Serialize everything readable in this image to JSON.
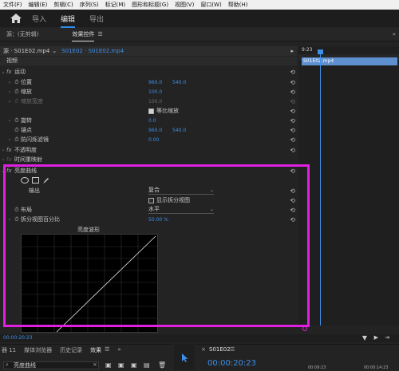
{
  "menu": [
    "文件(F)",
    "编辑(E)",
    "剪辑(C)",
    "序列(S)",
    "标记(M)",
    "图形和标题(G)",
    "视图(V)",
    "窗口(W)",
    "帮助(H)"
  ],
  "workspace_tabs": [
    "导入",
    "编辑",
    "导出"
  ],
  "panel_header": {
    "source": "源：(无剪辑)",
    "effect_controls": "效果控件"
  },
  "source_line": {
    "label": "源 · S01E02.mp4",
    "clip": "S01E02 · S01E02.mp4"
  },
  "video_label": "视频",
  "timeline": {
    "time": "9:23",
    "clip_name": "S01E02.mp4"
  },
  "effects": {
    "motion": {
      "label": "运动"
    },
    "position": {
      "label": "位置",
      "x": "960.0",
      "y": "540.0"
    },
    "scale": {
      "label": "缩放",
      "value": "100.0"
    },
    "scale_width": {
      "label": "缩放宽度",
      "value": "100.0"
    },
    "uniform_scale": {
      "label": "等比缩放"
    },
    "rotation": {
      "label": "旋转",
      "value": "0.0"
    },
    "anchor": {
      "label": "锚点",
      "x": "960.0",
      "y": "540.0"
    },
    "antiflicker": {
      "label": "防闪烁滤镜",
      "value": "0.00"
    },
    "opacity": {
      "label": "不透明度"
    },
    "time_remap": {
      "label": "时间重映射"
    },
    "lumetri_curves": {
      "label": "亮度曲线"
    },
    "output": {
      "label": "输出",
      "value": "复合"
    },
    "split_view_show": {
      "label": "显示拆分视图"
    },
    "layout": {
      "label": "布局",
      "value": "水平"
    },
    "split_percent": {
      "label": "拆分视图百分比",
      "value": "50.00 %"
    },
    "waveform_title": "亮度波形"
  },
  "bottom_time": "00:00:20:23",
  "bottom_panel": {
    "tabs": [
      "媒体浏览器",
      "历史记录",
      "效果"
    ],
    "tab_prefix": "器 11",
    "search_value": "亮度曲线"
  },
  "sequence": {
    "name": "S01E02",
    "timecode": "00:00:20:23",
    "small_time": "00:09:23",
    "right_time": "00:00:14:23"
  },
  "colors": {
    "accent": "#3d8fe8",
    "highlight": "#e020e0"
  }
}
